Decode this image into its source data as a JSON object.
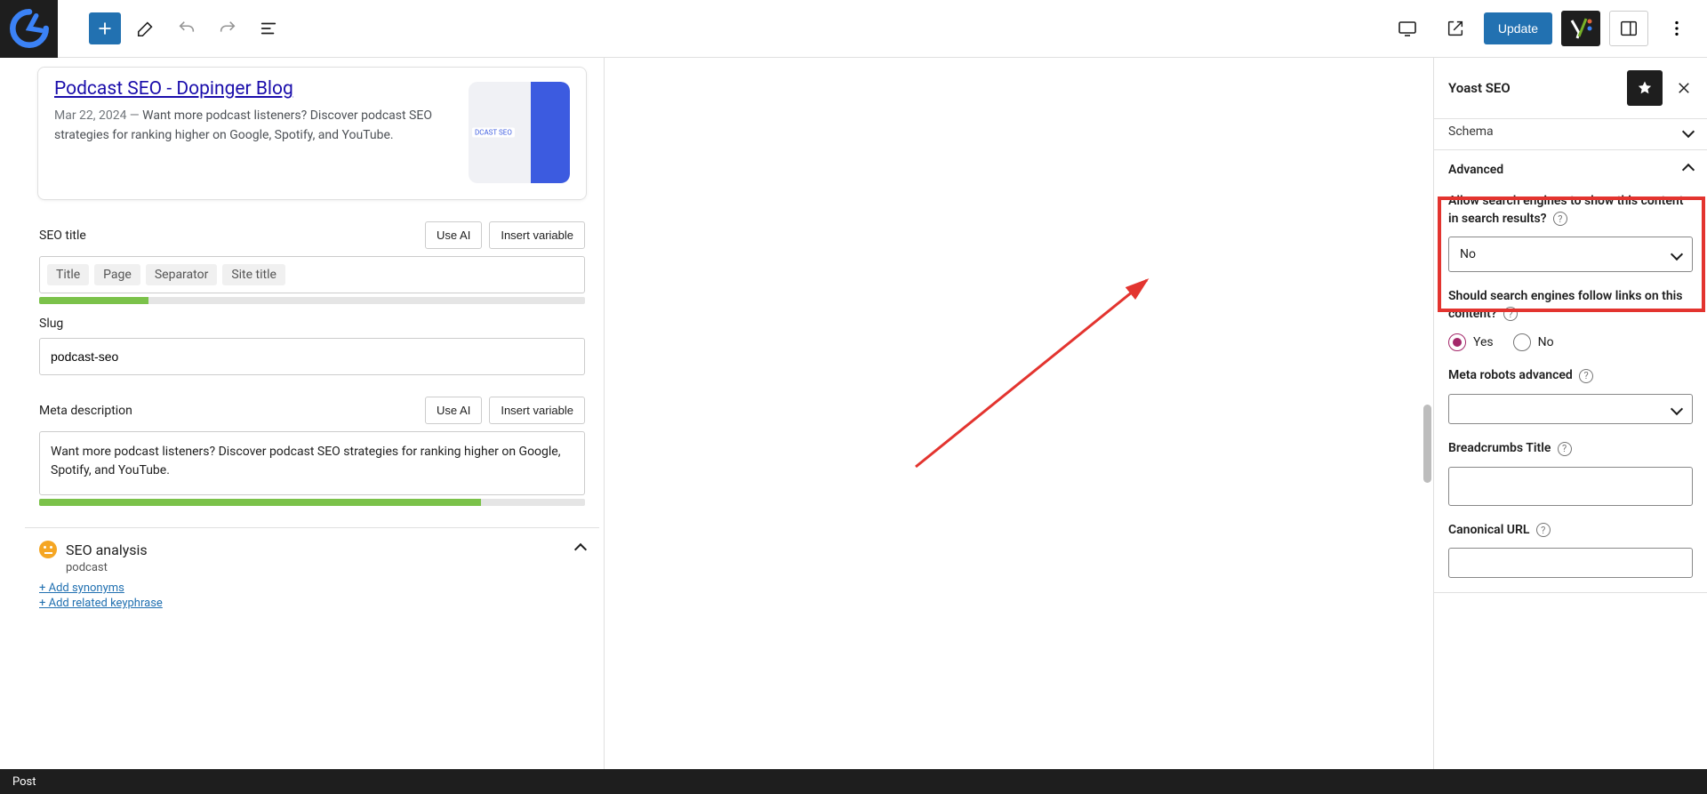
{
  "toolbar": {
    "update_label": "Update"
  },
  "preview": {
    "title": "Podcast SEO - Dopinger Blog",
    "date": "Mar 22, 2024",
    "separator": " — ",
    "desc": "Want more podcast listeners? Discover podcast SEO strategies for ranking higher on Google, Spotify, and YouTube.",
    "thumb_label": "DCAST SEO"
  },
  "seo_title": {
    "label": "SEO title",
    "use_ai": "Use AI",
    "insert_var": "Insert variable",
    "tags": [
      "Title",
      "Page",
      "Separator",
      "Site title"
    ],
    "progress_pct": 20
  },
  "slug": {
    "label": "Slug",
    "value": "podcast-seo"
  },
  "meta_desc": {
    "label": "Meta description",
    "use_ai": "Use AI",
    "insert_var": "Insert variable",
    "value": "Want more podcast listeners? Discover podcast SEO strategies for ranking higher on Google, Spotify, and YouTube.",
    "progress_pct": 81
  },
  "seo_analysis": {
    "title": "SEO analysis",
    "keyword": "podcast",
    "add_syn": "+ Add synonyms",
    "add_kp": "+ Add related keyphrase"
  },
  "sidebar": {
    "title": "Yoast SEO",
    "schema_label": "Schema",
    "advanced_label": "Advanced",
    "allow_search": {
      "label": "Allow search engines to show this content in search results?",
      "value": "No"
    },
    "follow_links": {
      "label": "Should search engines follow links on this content?",
      "yes": "Yes",
      "no": "No",
      "selected": "Yes"
    },
    "meta_robots": {
      "label": "Meta robots advanced"
    },
    "breadcrumbs": {
      "label": "Breadcrumbs Title"
    },
    "canonical": {
      "label": "Canonical URL"
    }
  },
  "footer": {
    "post_label": "Post"
  }
}
